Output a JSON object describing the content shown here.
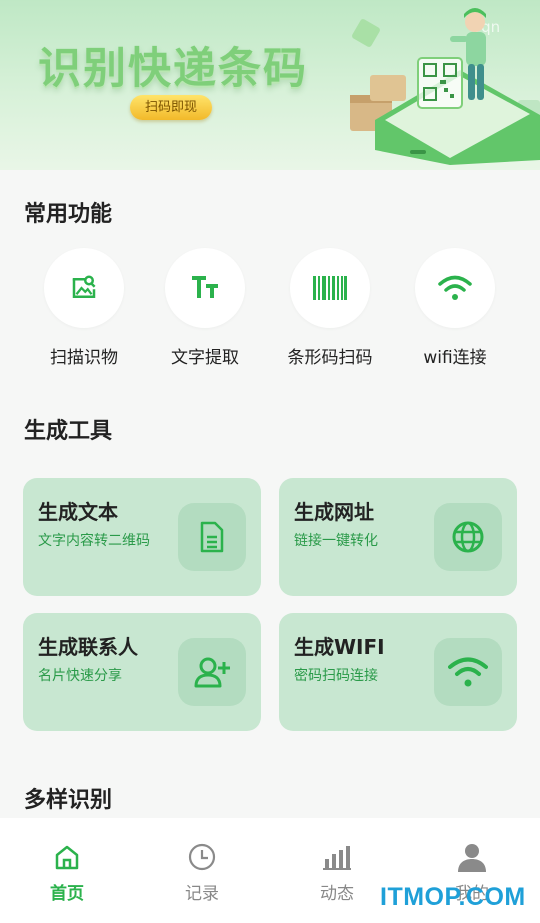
{
  "banner": {
    "title": "识别快递条码",
    "chip": "扫码即现",
    "watermark": "Tqn"
  },
  "sections": {
    "common": "常用功能",
    "tools": "生成工具",
    "multi": "多样识别"
  },
  "functions": [
    {
      "label": "扫描识物",
      "icon": "image-scan-icon"
    },
    {
      "label": "文字提取",
      "icon": "text-size-icon"
    },
    {
      "label": "条形码扫码",
      "icon": "barcode-icon"
    },
    {
      "label": "wifi连接",
      "icon": "wifi-icon"
    }
  ],
  "tools": [
    {
      "title": "生成文本",
      "subtitle": "文字内容转二维码",
      "icon": "document-icon"
    },
    {
      "title": "生成网址",
      "subtitle": "链接一键转化",
      "icon": "globe-icon"
    },
    {
      "title": "生成联系人",
      "subtitle": "名片快速分享",
      "icon": "add-user-icon"
    },
    {
      "title": "生成WIFI",
      "subtitle": "密码扫码连接",
      "icon": "wifi-icon"
    }
  ],
  "nav": [
    {
      "label": "首页",
      "icon": "home-icon",
      "active": true
    },
    {
      "label": "记录",
      "icon": "clock-icon",
      "active": false
    },
    {
      "label": "动态",
      "icon": "bar-chart-icon",
      "active": false
    },
    {
      "label": "我的",
      "icon": "user-icon",
      "active": false
    }
  ],
  "watermark": "ITMOP.COM",
  "colors": {
    "accent": "#2bb24c",
    "card_bg": "#c8e7d1",
    "icon_bg": "#b3dcc0",
    "inactive": "#888888"
  }
}
